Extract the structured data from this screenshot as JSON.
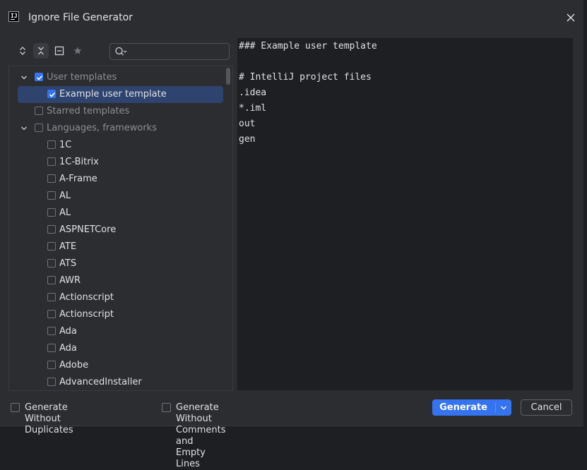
{
  "window": {
    "title": "Ignore File Generator"
  },
  "toolbar": {
    "buttons": [
      "expand-all-icon",
      "collapse-all-icon",
      "collapse-icon",
      "star-icon"
    ],
    "search_value": "",
    "search_placeholder": ""
  },
  "tree": {
    "groups": [
      {
        "label": "User templates",
        "expanded": true,
        "checked": true,
        "dimmed": true
      },
      {
        "label": "Example user template",
        "checked": true,
        "selected": true
      },
      {
        "label": "Starred templates",
        "checked": false,
        "dimmed": true
      },
      {
        "label": "Languages, frameworks",
        "expanded": true,
        "checked": false,
        "dimmed": true
      }
    ],
    "items": [
      "1C",
      "1C-Bitrix",
      "A-Frame",
      "AL",
      "AL",
      "ASPNETCore",
      "ATE",
      "ATS",
      "AWR",
      "Actionscript",
      "Actionscript",
      "Ada",
      "Ada",
      "Adobe",
      "AdvancedInstaller"
    ]
  },
  "preview": {
    "lines": [
      "### Example user template",
      "",
      "# IntelliJ project files",
      ".idea",
      "*.iml",
      "out",
      "gen"
    ]
  },
  "footer": {
    "no_duplicates_label": "Generate Without Duplicates",
    "no_comments_label": "Generate Without Comments and Empty Lines",
    "generate_label": "Generate",
    "cancel_label": "Cancel"
  },
  "colors": {
    "accent": "#3574f0",
    "selection": "#2e436e",
    "panel_bg": "#2b2d30",
    "editor_bg": "#1e1f22"
  }
}
